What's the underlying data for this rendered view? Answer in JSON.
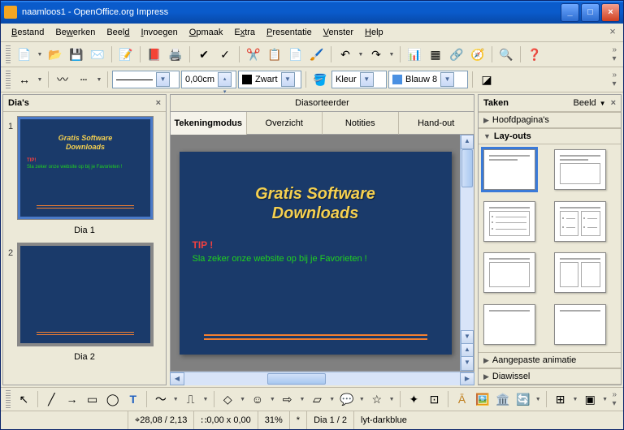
{
  "title": "naamloos1 - OpenOffice.org Impress",
  "menus": [
    "Bestand",
    "Bewerken",
    "Beeld",
    "Invoegen",
    "Opmaak",
    "Extra",
    "Presentatie",
    "Venster",
    "Help"
  ],
  "line_width": "0,00cm",
  "color_name": "Zwart",
  "fill_mode": "Kleur",
  "fill_color": "Blauw 8",
  "slides_panel_title": "Dia's",
  "slides": [
    {
      "num": "1",
      "label": "Dia 1",
      "title": "Gratis Software\nDownloads",
      "tip": "TIP!",
      "fav": "Sla zeker onze website op bij je Favorieten !",
      "has_content": true
    },
    {
      "num": "2",
      "label": "Dia 2",
      "has_content": false
    }
  ],
  "sorter_title": "Diasorteerder",
  "tabs": [
    {
      "label": "Tekeningmodus",
      "active": true
    },
    {
      "label": "Overzicht"
    },
    {
      "label": "Notities"
    },
    {
      "label": "Hand-out"
    }
  ],
  "main_slide": {
    "title1": "Gratis Software",
    "title2": "Downloads",
    "tip": "TIP !",
    "fav": "Sla zeker onze website op bij je Favorieten !"
  },
  "task_panel": {
    "title": "Taken",
    "view": "Beeld",
    "sections": [
      "Hoofdpagina's",
      "Lay-outs",
      "Aangepaste animatie",
      "Diawissel"
    ]
  },
  "status": {
    "pos": "28,08 / 2,13",
    "size": "0,00 x 0,00",
    "zoom": "31%",
    "star": "*",
    "slide": "Dia 1 / 2",
    "layout": "lyt-darkblue"
  }
}
